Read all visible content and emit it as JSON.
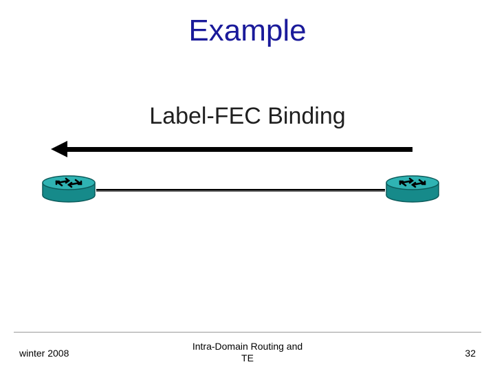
{
  "title": "Example",
  "binding_label": "Label-FEC Binding",
  "routers": {
    "left": {
      "fill": "#168a8a",
      "stroke": "#0b5a5a"
    },
    "right": {
      "fill": "#168a8a",
      "stroke": "#0b5a5a"
    }
  },
  "footer": {
    "left": "winter 2008",
    "center": "Intra-Domain Routing and\nTE",
    "page_number": "32"
  }
}
